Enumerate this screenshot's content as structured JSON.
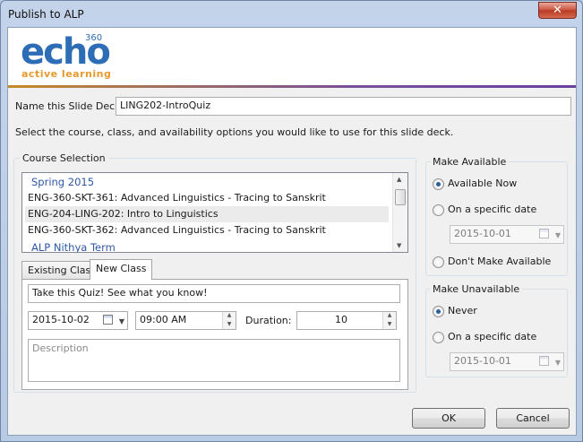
{
  "window": {
    "title": "Publish to ALP",
    "close_glyph": "✕"
  },
  "logo": {
    "brand": "echo",
    "superscript": "360",
    "tagline": "active learning"
  },
  "name_field": {
    "label": "Name this Slide Deck:",
    "value": "LING202-IntroQuiz"
  },
  "instructions": "Select the course, class, and availability options you would like to use for this slide deck.",
  "course_selection": {
    "title": "Course Selection",
    "groups": [
      "Spring 2015",
      "ALP Nithya Term"
    ],
    "courses": [
      "ENG-360-SKT-361: Advanced Linguistics - Tracing to Sanskrit",
      "ENG-204-LING-202: Intro to Linguistics",
      "ENG-360-SKT-362: Advanced Linguistics - Tracing to Sanskrit"
    ],
    "selected_index": 1
  },
  "tabs": [
    {
      "label": "Existing Class",
      "active": false
    },
    {
      "label": "New Class",
      "active": true
    }
  ],
  "new_class": {
    "class_name": "Take this Quiz! See what you know!",
    "date": "2015-10-02",
    "time": "09:00 AM",
    "duration_label": "Duration:",
    "duration": "10",
    "description_placeholder": "Description"
  },
  "make_available": {
    "title": "Make Available",
    "options": [
      "Available Now",
      "On a specific date",
      "Don't Make Available"
    ],
    "selected": "Available Now",
    "date": "2015-10-01"
  },
  "make_unavailable": {
    "title": "Make Unavailable",
    "options": [
      "Never",
      "On a specific date"
    ],
    "selected": "Never",
    "date": "2015-10-01"
  },
  "buttons": {
    "ok": "OK",
    "cancel": "Cancel"
  },
  "colors": {
    "accent": "#2d6db5",
    "tagline": "#e69a2e",
    "group_header": "#2f57a4",
    "titlebar": "#c3d3ea"
  }
}
